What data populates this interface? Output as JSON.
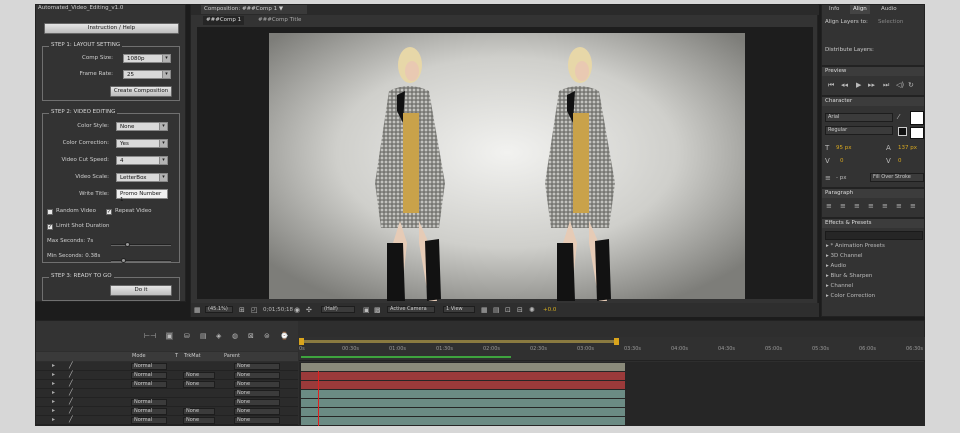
{
  "script_panel": {
    "title": "Automated_Video_Editing_v1.0",
    "help_button": "Instruction / Help",
    "step1": {
      "legend": "STEP 1: LAYOUT SETTING",
      "comp_size_label": "Comp Size:",
      "comp_size_value": "1080p",
      "frame_rate_label": "Frame Rate:",
      "frame_rate_value": "25",
      "create_button": "Create Composition"
    },
    "step2": {
      "legend": "STEP 2: VIDEO EDITING",
      "color_style_label": "Color Style:",
      "color_style_value": "None",
      "color_correction_label": "Color Correction:",
      "color_correction_value": "Yes",
      "cut_speed_label": "Video Cut Speed:",
      "cut_speed_value": "4",
      "scale_label": "Video Scale:",
      "scale_value": "LetterBox",
      "title_label": "Write Title:",
      "title_value": "Promo Number 1",
      "random_video": "Random Video",
      "repeat_video": "Repeat Video",
      "limit_shot": "Limit Shot Duration",
      "max_seconds": "Max Seconds: 7s",
      "min_seconds": "Min Seconds: 0.38s"
    },
    "step3": {
      "legend": "STEP 3: READY TO GO",
      "do_it_button": "Do it"
    }
  },
  "composition": {
    "tab": "Composition: ###Comp 1",
    "menu_glyph": "▼",
    "tab2": "###Comp 1",
    "tab3": "###Comp Title",
    "footer": {
      "zoom": "(45.1%)",
      "timecode": "0;01;50;18",
      "resolution": "(Half)",
      "camera": "Active Camera",
      "views": "1 View",
      "exposure": "+0.0"
    }
  },
  "right_panels": {
    "top_tabs": [
      "Info",
      "Align",
      "Audio"
    ],
    "align_layers_to": "Align Layers to:",
    "align_target": "Selection",
    "distribute_layers": "Distribute Layers:",
    "preview": "Preview",
    "character": "Character",
    "font": "Arial",
    "font_style": "Regular",
    "font_size": "95 px",
    "leading": "137 px",
    "kerning": "0",
    "tracking": "0",
    "stroke_width": "- px",
    "stroke_mode": "Fill Over Stroke",
    "paragraph": "Paragraph",
    "effects": "Effects & Presets",
    "effects_list": [
      "* Animation Presets",
      "3D Channel",
      "Audio",
      "Blur & Sharpen",
      "Channel",
      "Color Correction"
    ]
  },
  "timeline": {
    "ruler_labels": [
      "0s",
      "00:30s",
      "01:00s",
      "01:30s",
      "02:00s",
      "02:30s",
      "03:00s",
      "03:30s",
      "04:00s",
      "04:30s",
      "05:00s",
      "05:30s",
      "06:00s",
      "06:30s"
    ],
    "columns": {
      "mode": "Mode",
      "t": "T",
      "trkmat": "TrkMat",
      "parent": "Parent"
    },
    "rows": [
      {
        "mode": "Normal",
        "trkmat": "",
        "parent": "None"
      },
      {
        "mode": "Normal",
        "trkmat": "None",
        "parent": "None"
      },
      {
        "mode": "Normal",
        "trkmat": "None",
        "parent": "None"
      },
      {
        "mode": "",
        "trkmat": "",
        "parent": "None"
      },
      {
        "mode": "Normal",
        "trkmat": "",
        "parent": "None"
      },
      {
        "mode": "Normal",
        "trkmat": "None",
        "parent": "None"
      },
      {
        "mode": "Normal",
        "trkmat": "None",
        "parent": "None"
      }
    ],
    "side_label": "p3",
    "bar_colors": [
      "#8a8a7a",
      "#9b3a3a",
      "#9b3a3a",
      "#6b8b84",
      "#6b8b84",
      "#6b8b84",
      "#6b8b84"
    ]
  }
}
